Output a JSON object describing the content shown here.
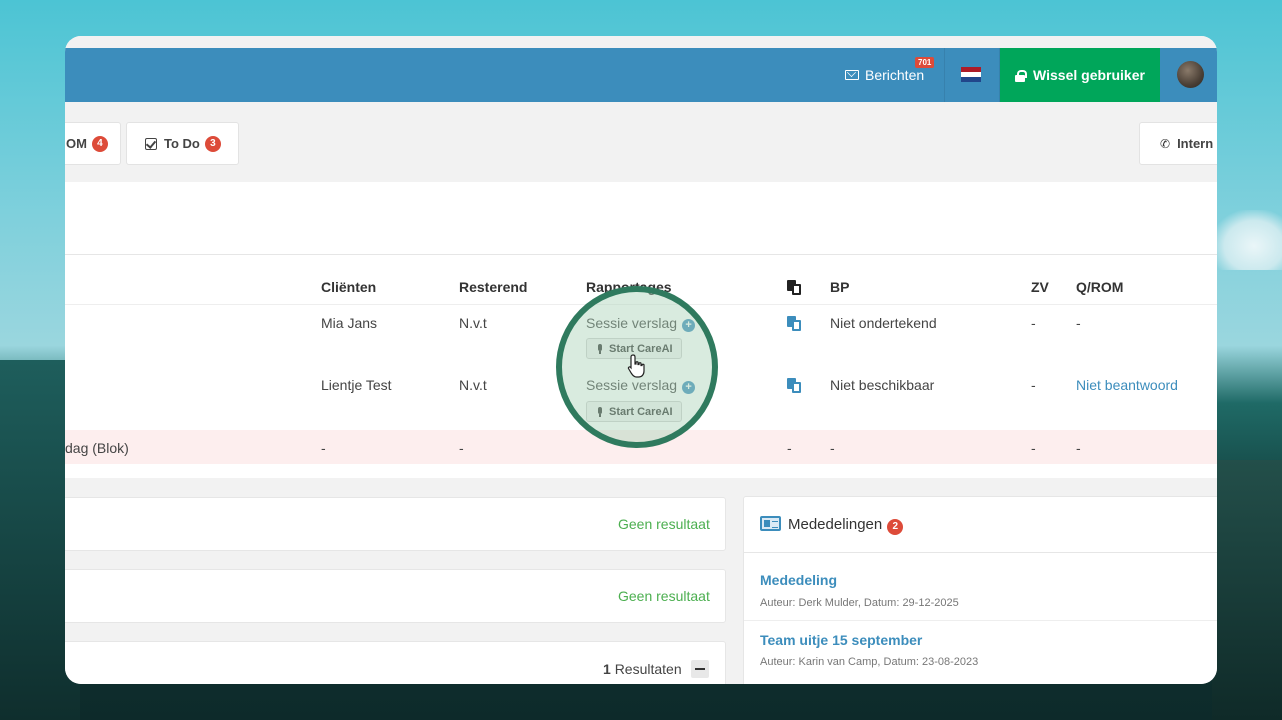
{
  "topbar": {
    "messages_label": "Berichten",
    "messages_count": "701",
    "switch_user_label": "Wissel gebruiker"
  },
  "tabs": {
    "rom_label": "OM",
    "rom_count": "4",
    "todo_label": "To Do",
    "todo_count": "3",
    "intern_label": "Intern"
  },
  "table": {
    "headers": {
      "clients": "Cliënten",
      "remaining": "Resterend",
      "reports": "Rapportages",
      "bp": "BP",
      "zv": "ZV",
      "qrom": "Q/ROM"
    },
    "rows": [
      {
        "client": "Mia Jans",
        "remaining": "N.v.t",
        "report": "Sessie verslag",
        "careai_label": "Start CareAI",
        "bp": "Niet ondertekend",
        "zv": "-",
        "qrom": "-"
      },
      {
        "client": "Lientje Test",
        "remaining": "N.v.t",
        "report": "Sessie verslag",
        "careai_label": "Start CareAI",
        "bp": "Niet beschikbaar",
        "zv": "-",
        "qrom": "Niet beantwoord"
      },
      {
        "title_fragment": "dag (Blok)",
        "client": "-",
        "remaining": "-",
        "doc": "-",
        "bp": "-",
        "zv": "-",
        "qrom": "-"
      }
    ]
  },
  "panels": {
    "no_result_1": "Geen resultaat",
    "no_result_2": "Geen resultaat",
    "results_count": "1",
    "results_label": "Resultaten"
  },
  "announcements": {
    "title": "Mededelingen",
    "count": "2",
    "items": [
      {
        "title": "Mededeling",
        "meta": "Auteur: Derk Mulder, Datum: 29-12-2025"
      },
      {
        "title": "Team uitje 15 september",
        "meta": "Auteur: Karin van Camp, Datum: 23-08-2023"
      }
    ]
  },
  "colors": {
    "topbar": "#3c8dbc",
    "switch_user": "#00a65a",
    "badge": "#dd4b39",
    "link": "#3c8dbc",
    "no_result": "#4caf50",
    "spotlight_ring": "#2f7a5e"
  }
}
